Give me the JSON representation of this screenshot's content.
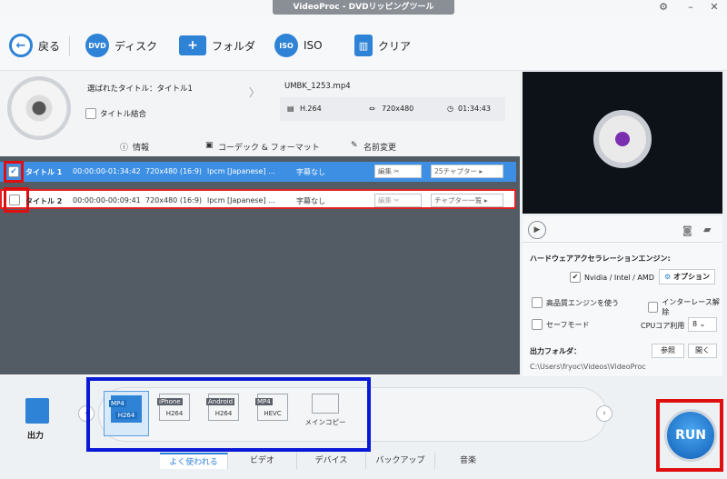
{
  "window": {
    "title": "VideoProc - DVDリッピングツール",
    "buttons": [
      "settings",
      "minimize",
      "close"
    ]
  },
  "toolbar": {
    "back_label": "戻る",
    "disc_label": "ディスク",
    "folder_label": "フォルダ",
    "iso_label": "ISO",
    "clear_label": "クリア",
    "dvd_badge": "DVD",
    "iso_badge": "ISO"
  },
  "source": {
    "selected_title": "選ばれたタイトル：タイトル1",
    "merge_titles_label": "タイトル結合",
    "output_file": "UMBK_1253.mp4",
    "codec": "H.264",
    "resolution": "720x480",
    "duration": "01:34:43"
  },
  "info_bar": {
    "info_label": "情報",
    "codec_label": "コーデック & フォーマット",
    "rename_label": "名前変更"
  },
  "titles": [
    {
      "checked": true,
      "name": "タイトル 1",
      "timecode": "00:00:00-01:34:42",
      "resolution": "720x480 (16:9)",
      "audio": "lpcm [Japanese] ...",
      "subtitle": "字幕なし",
      "edit_label": "編集",
      "chapter_label": "25チャプター"
    },
    {
      "checked": false,
      "name": "タイトル 2",
      "timecode": "00:00:00-00:09:41",
      "resolution": "720x480 (16:9)",
      "audio": "lpcm [Japanese] ...",
      "subtitle": "字幕なし",
      "edit_label": "編集",
      "chapter_label": "チャプター一覧"
    }
  ],
  "hardware": {
    "title": "ハードウェアアクセラレーションエンジン:",
    "gpu_label": "Nvidia / Intel / AMD",
    "options_label": "オプション",
    "high_quality_label": "高品質エンジンを使う",
    "deinterlace_label": "インターレース解除",
    "safe_mode_label": "セーフモード",
    "cpu_label": "CPUコア利用",
    "cpu_value": "8"
  },
  "output": {
    "folder_label": "出力フォルダ：",
    "path": "C:\\Users\\fryoc\\Videos\\VideoProc",
    "browse_label": "参照",
    "open_label": "開く"
  },
  "output_section_label": "出力",
  "formats": [
    {
      "tag": "MP4",
      "codec": "H264",
      "selected": true
    },
    {
      "tag": "iPhone",
      "codec": "H264",
      "selected": false
    },
    {
      "tag": "Android",
      "codec": "H264",
      "selected": false
    },
    {
      "tag": "MP4",
      "codec": "HEVC",
      "selected": false
    },
    {
      "tag": "",
      "codec": "メインコピー",
      "selected": false
    }
  ],
  "tabs": [
    "よく使われる",
    "ビデオ",
    "デバイス",
    "バックアップ",
    "音楽"
  ],
  "run_label": "RUN",
  "colors": {
    "accent": "#3d8fe3",
    "highlight_red": "#e00f0f",
    "highlight_blue": "#0a19d6",
    "list_bg": "#535b64"
  }
}
